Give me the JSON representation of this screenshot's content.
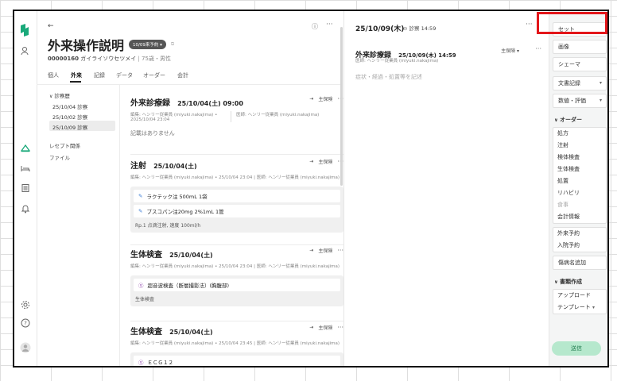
{
  "main": {
    "title": "外来操作説明",
    "reservation_badge": "10/09来予約 ▾",
    "patient_id": "00000160",
    "patient_kana": "ガイライソウセツメイ",
    "patient_info": "75歳・男性",
    "tabs": [
      "個人",
      "外来",
      "記録",
      "データ",
      "オーダー",
      "会計"
    ],
    "tree": {
      "header": "診察歴",
      "items": [
        "25/10/04 診察",
        "25/10/02 診察",
        "25/10/09 診察"
      ],
      "links": [
        "レセプト関係",
        "ファイル"
      ]
    },
    "cards": [
      {
        "title": "外来診療録",
        "date": "25/10/04(土) 09:00",
        "insurance": "主保険",
        "meta1": "編集: ヘンリー従業員 (miyuki.nakajima) • 2025/10/04 23:04",
        "meta2": "医師: ヘンリー従業員 (miyuki.nakajima)",
        "empty_text": "記載はありません"
      },
      {
        "title": "注射",
        "date": "25/10/04(土)",
        "insurance": "主保険",
        "meta": "編集: ヘンリー従業員 (miyuki.nakajima) • 25/10/04 23:04 | 医師: ヘンリー従業員 (miyuki.nakajima)",
        "lines": [
          "ラクテック注 500mL 1袋",
          "ブスコパン注20mg 2%1mL 1管"
        ],
        "note": "Rp.1 点滴注射, 速度 100ml/h"
      },
      {
        "title": "生体検査",
        "date": "25/10/04(土)",
        "insurance": "主保険",
        "meta": "編集: ヘンリー従業員 (miyuki.nakajima) • 25/10/04 23:04 | 医師: ヘンリー従業員 (miyuki.nakajima)",
        "lines": [
          "超音波検査（断層撮影法）(胸腹部)"
        ],
        "note": "生体検査"
      },
      {
        "title": "生体検査",
        "date": "25/10/04(土)",
        "insurance": "主保険",
        "meta": "編集: ヘンリー従業員 (miyuki.nakajima) • 25/10/04 23:45 | 医師: ヘンリー従業員 (miyuki.nakajima)",
        "lines": [
          "ＥＣＧ１２"
        ]
      }
    ]
  },
  "right": {
    "date": "25/10/09(木)",
    "visit": "診察 14:59",
    "record_title": "外来診療録",
    "record_datetime": "25/10/09(木) 14:59",
    "insurance": "主保険 ▾",
    "doctor": "医師: ヘンリー従業員 (miyuki.nakajima)",
    "placeholder": "症状・経過・処置等を記述"
  },
  "side": {
    "top_buttons": [
      "セット",
      "画像",
      "シェーマ"
    ],
    "dropdowns": [
      "文書記録",
      "数値・評価"
    ],
    "order_header": "オーダー",
    "orders": [
      "処方",
      "注射",
      "検体検査",
      "生体検査",
      "処置",
      "リハビリ",
      "食事",
      "会計情報"
    ],
    "appointments": [
      "外来予約",
      "入院予約"
    ],
    "disease_add": "傷病名追加",
    "docs_header": "書類作成",
    "docs": [
      "アップロード",
      "テンプレート"
    ],
    "send": "送信"
  }
}
